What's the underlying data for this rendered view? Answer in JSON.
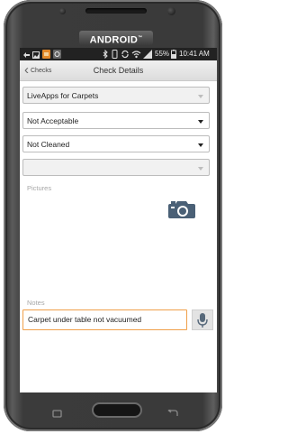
{
  "device": {
    "brand_label": "ANDROID",
    "brand_mark": "™"
  },
  "statusbar": {
    "battery_percent": "55%",
    "time": "10:41 AM",
    "left_icons": [
      "back-arrow-icon",
      "image-icon",
      "orange-app-icon",
      "at-icon"
    ],
    "right_icons": [
      "bluetooth-icon",
      "phone-signal-icon",
      "sync-icon",
      "wifi-icon",
      "signal-bars-icon",
      "battery-icon"
    ]
  },
  "appbar": {
    "back_label": "Checks",
    "title": "Check Details"
  },
  "form": {
    "selects": [
      {
        "value": "LiveApps for Carpets",
        "disabled": true
      },
      {
        "value": "Not Acceptable",
        "disabled": false
      },
      {
        "value": "Not Cleaned",
        "disabled": false
      },
      {
        "value": "",
        "disabled": true
      }
    ],
    "pictures_label": "Pictures",
    "notes_label": "Notes",
    "notes_value": "Carpet under table not vacuumed"
  },
  "colors": {
    "notes_border": "#f0a04a",
    "statusbar_bg": "#222222",
    "camera_icon": "#4a6076"
  }
}
